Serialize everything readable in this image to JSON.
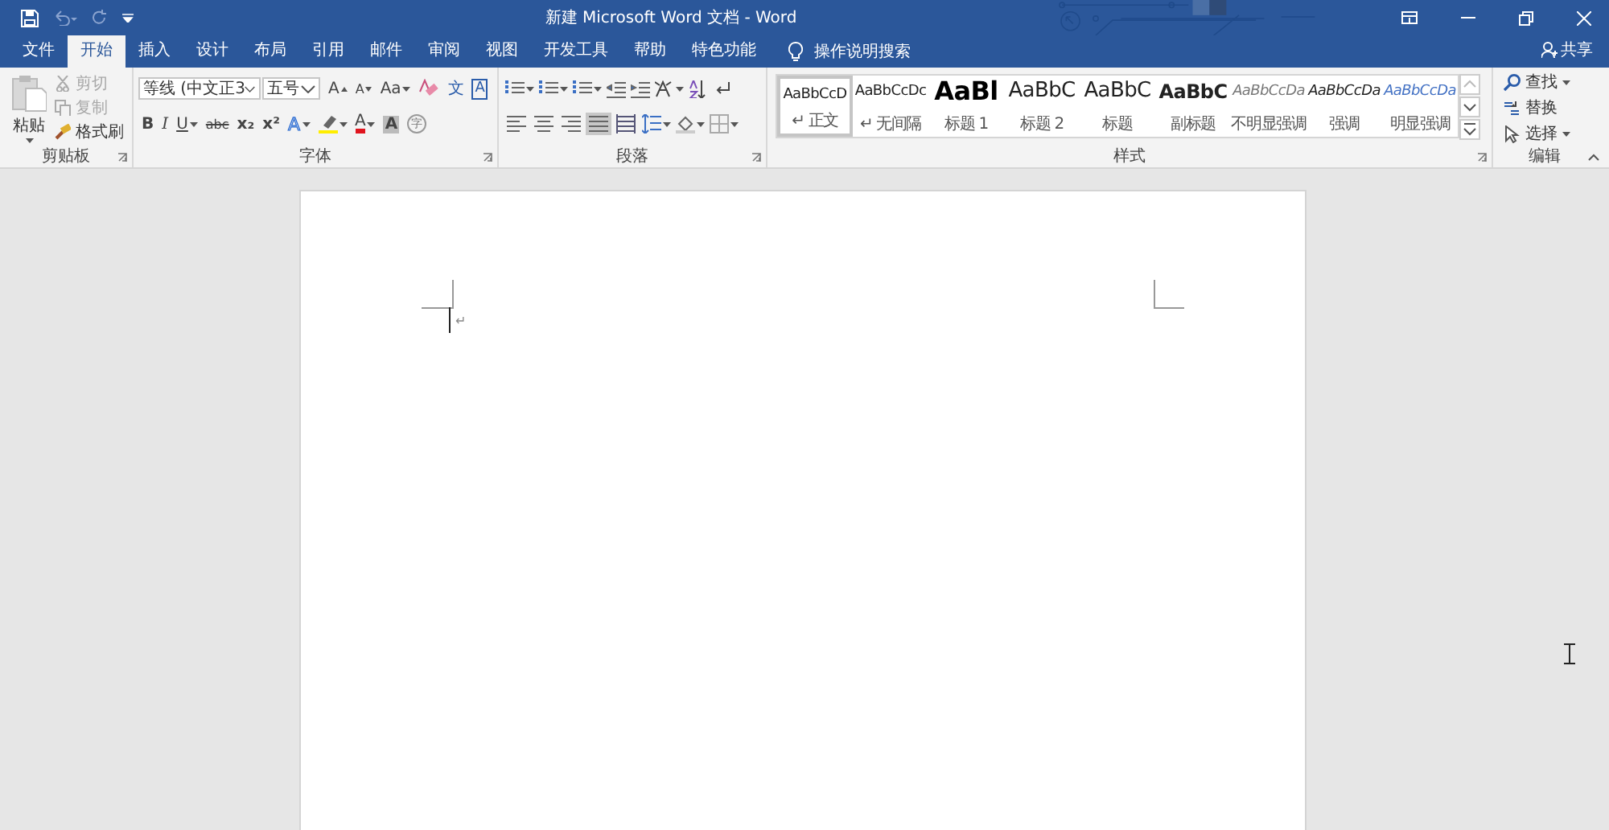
{
  "window": {
    "title": "新建 Microsoft Word 文档  -  Word"
  },
  "tabs": [
    {
      "label": "文件",
      "selected": false
    },
    {
      "label": "开始",
      "selected": true
    },
    {
      "label": "插入",
      "selected": false
    },
    {
      "label": "设计",
      "selected": false
    },
    {
      "label": "布局",
      "selected": false
    },
    {
      "label": "引用",
      "selected": false
    },
    {
      "label": "邮件",
      "selected": false
    },
    {
      "label": "审阅",
      "selected": false
    },
    {
      "label": "视图",
      "selected": false
    },
    {
      "label": "开发工具",
      "selected": false
    },
    {
      "label": "帮助",
      "selected": false
    },
    {
      "label": "特色功能",
      "selected": false
    }
  ],
  "tell_me": {
    "placeholder": "操作说明搜索"
  },
  "share": {
    "label": "共享"
  },
  "clipboard": {
    "title": "剪贴板",
    "paste": "粘贴",
    "items": [
      {
        "label": "剪切",
        "disabled": true
      },
      {
        "label": "复制",
        "disabled": true
      },
      {
        "label": "格式刷",
        "disabled": false
      }
    ]
  },
  "font": {
    "title": "字体",
    "font_name": "等线 (中文正3",
    "font_size": "五号",
    "row_1": [
      {
        "kind": "grow",
        "label": "A",
        "dropdown": false
      },
      {
        "kind": "shrink",
        "label": "A",
        "dropdown": false
      },
      {
        "kind": "plain",
        "label": "Aa",
        "dropdown": true
      },
      {
        "kind": "eraser",
        "dropdown": false
      },
      {
        "kind": "pinyin",
        "label": "文",
        "dropdown": false
      },
      {
        "kind": "boxed",
        "label": "A",
        "dropdown": false
      }
    ],
    "row_2": [
      {
        "kind": "bold",
        "label": "B",
        "dropdown": false
      },
      {
        "kind": "italic",
        "label": "I",
        "dropdown": false
      },
      {
        "kind": "underline",
        "label": "U",
        "dropdown": true
      },
      {
        "kind": "strike",
        "label": "abc",
        "dropdown": false
      },
      {
        "kind": "sub",
        "label": "x₂",
        "dropdown": false
      },
      {
        "kind": "sup",
        "label": "x²",
        "dropdown": false
      },
      {
        "kind": "effect",
        "label": "A",
        "dropdown": true
      },
      {
        "kind": "highlight",
        "dropdown": true
      },
      {
        "kind": "color",
        "label": "A",
        "dropdown": true
      },
      {
        "kind": "shaded",
        "label": "A",
        "dropdown": false
      },
      {
        "kind": "circle",
        "label": "字",
        "dropdown": false
      }
    ]
  },
  "paragraph": {
    "title": "段落",
    "alignments": [
      {
        "selected": false
      },
      {
        "selected": false
      },
      {
        "selected": false
      },
      {
        "selected": true
      },
      {
        "selected": false
      }
    ]
  },
  "styles": {
    "title": "样式",
    "items": [
      {
        "sample": "AaBbCcD",
        "name": "↵ 正文",
        "kind": "normal",
        "selected": true
      },
      {
        "sample": "AaBbCcDc",
        "name": "↵ 无间隔",
        "kind": "normal",
        "selected": false
      },
      {
        "sample": "AaBl",
        "name": "标题 1",
        "kind": "heading1",
        "selected": false
      },
      {
        "sample": "AaBbC",
        "name": "标题 2",
        "kind": "heading2",
        "selected": false
      },
      {
        "sample": "AaBbC",
        "name": "标题",
        "kind": "title",
        "selected": false
      },
      {
        "sample": "AaBbC",
        "name": "副标题",
        "kind": "subtitle",
        "selected": false
      },
      {
        "sample": "AaBbCcDa",
        "name": "不明显强调",
        "kind": "subtle",
        "selected": false
      },
      {
        "sample": "AaBbCcDa",
        "name": "强调",
        "kind": "emphasis",
        "selected": false
      },
      {
        "sample": "AaBbCcDa",
        "name": "明显强调",
        "kind": "intense",
        "selected": false
      }
    ]
  },
  "editing": {
    "title": "编辑",
    "items": [
      {
        "label": "查找",
        "dropdown": true
      },
      {
        "label": "替换",
        "dropdown": false
      },
      {
        "label": "选择",
        "dropdown": true
      }
    ]
  },
  "document": {
    "paragraph_mark": "↵"
  }
}
